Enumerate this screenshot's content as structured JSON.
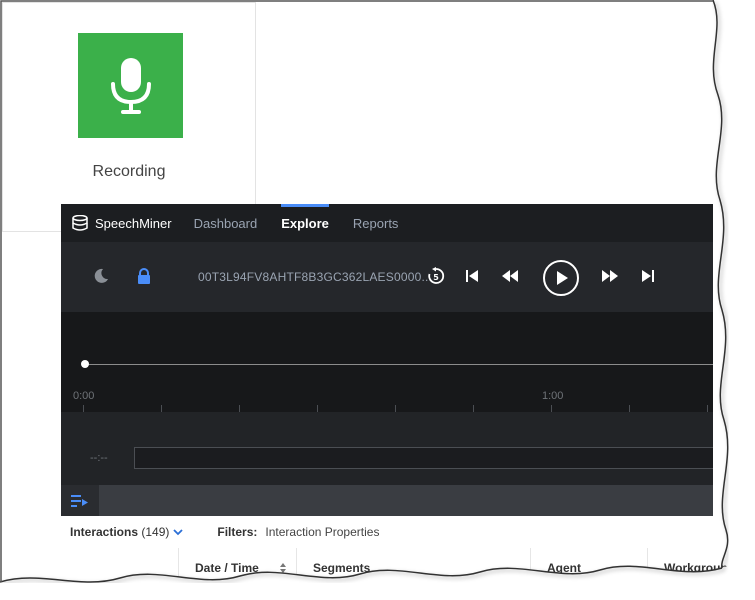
{
  "tile": {
    "label": "Recording",
    "color": "#3bb04a",
    "icon": "microphone-icon"
  },
  "nav": {
    "brand": "SpeechMiner",
    "items": [
      {
        "label": "Dashboard",
        "active": false
      },
      {
        "label": "Explore",
        "active": true
      },
      {
        "label": "Reports",
        "active": false
      }
    ],
    "accent": "#4a8df8"
  },
  "player": {
    "interaction_id": "00T3L94FV8AHTF8B3GC362LAES0000...",
    "controls": [
      "moon-icon",
      "lock-icon",
      "replay-5-icon",
      "skip-previous-icon",
      "rewind-icon",
      "play-icon",
      "fast-forward-icon",
      "skip-next-icon"
    ]
  },
  "timeline": {
    "ticks": [
      {
        "label": "0:00"
      },
      {
        "label": "1:00"
      }
    ],
    "segment_time_placeholder": "--:--"
  },
  "filter_bar": {
    "interactions_label": "Interactions",
    "interactions_count": "(149)",
    "filters_label": "Filters:",
    "filters_value": "Interaction Properties"
  },
  "table": {
    "columns": [
      {
        "label": ""
      },
      {
        "label": "Date / Time",
        "sortable": true
      },
      {
        "label": "Segments"
      },
      {
        "label": "Agent"
      },
      {
        "label": "Workgroup"
      }
    ]
  }
}
